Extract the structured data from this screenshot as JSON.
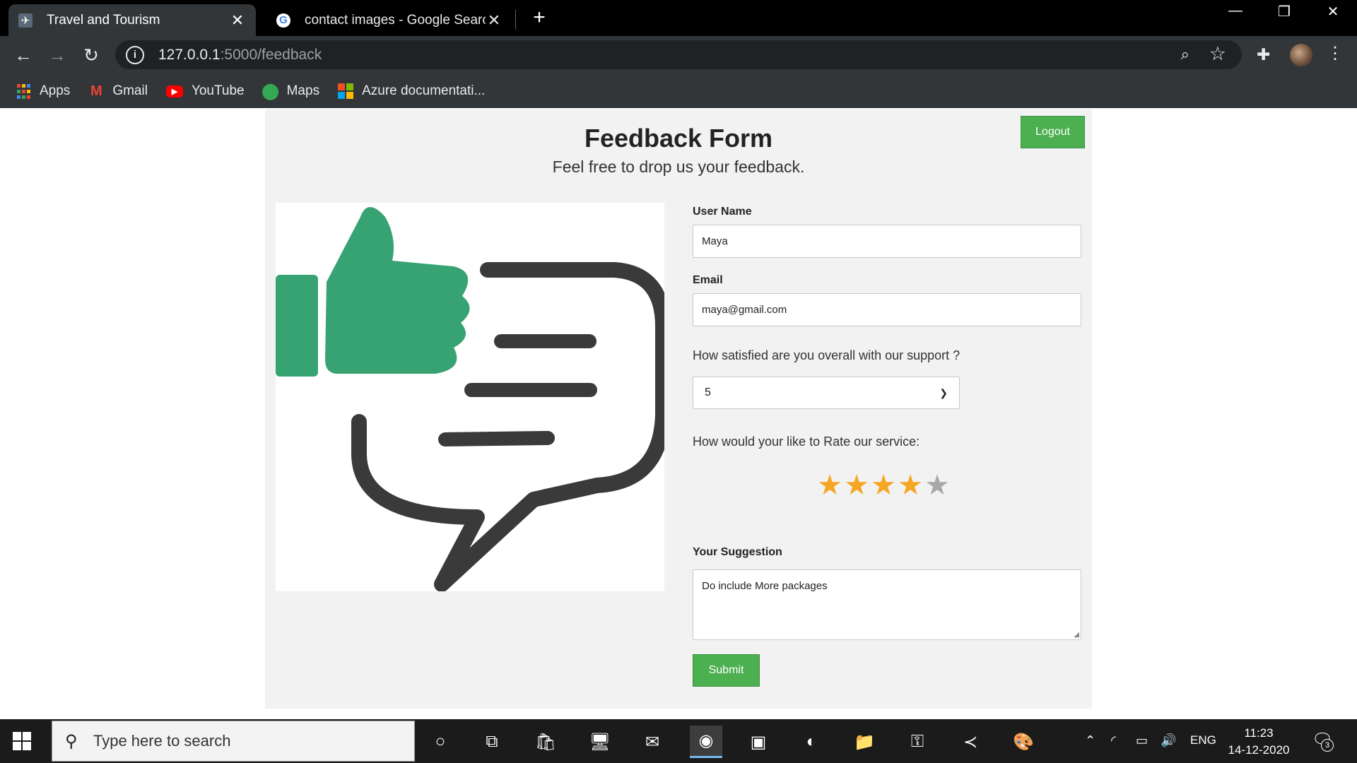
{
  "browser": {
    "tabs": [
      {
        "title": "Travel and Tourism",
        "active": true,
        "favicon": "travel-favicon-icon"
      },
      {
        "title": "contact images - Google Search",
        "active": false,
        "favicon": "google-favicon-icon"
      }
    ],
    "url_host": "127.0.0.1",
    "url_path": ":5000/feedback",
    "bookmarks": [
      {
        "label": "Apps",
        "icon": "apps-grid-icon"
      },
      {
        "label": "Gmail",
        "icon": "gmail-icon"
      },
      {
        "label": "YouTube",
        "icon": "youtube-icon"
      },
      {
        "label": "Maps",
        "icon": "maps-pin-icon"
      },
      {
        "label": "Azure documentati...",
        "icon": "microsoft-icon"
      }
    ]
  },
  "feedback": {
    "title": "Feedback Form",
    "subtitle": "Feel free to drop us your feedback.",
    "logout_label": "Logout",
    "username_label": "User Name",
    "username_value": "Maya",
    "email_label": "Email",
    "email_value": "maya@gmail.com",
    "satisfaction_question": "How satisfied are you overall with our support ?",
    "satisfaction_value": "5",
    "rating_question": "How would your like to Rate our service:",
    "rating_value": 4,
    "rating_max": 5,
    "suggestion_label": "Your Suggestion",
    "suggestion_value": "Do include More packages",
    "submit_label": "Submit",
    "brand_colors": {
      "button": "#4caf50",
      "thumb": "#37a372",
      "bubble": "#3a3a3a",
      "star_on": "#f5a623",
      "star_off": "#a8a8a8"
    }
  },
  "taskbar": {
    "search_placeholder": "Type here to search",
    "language": "ENG",
    "time": "11:23",
    "date": "14-12-2020",
    "notification_count": "3"
  }
}
